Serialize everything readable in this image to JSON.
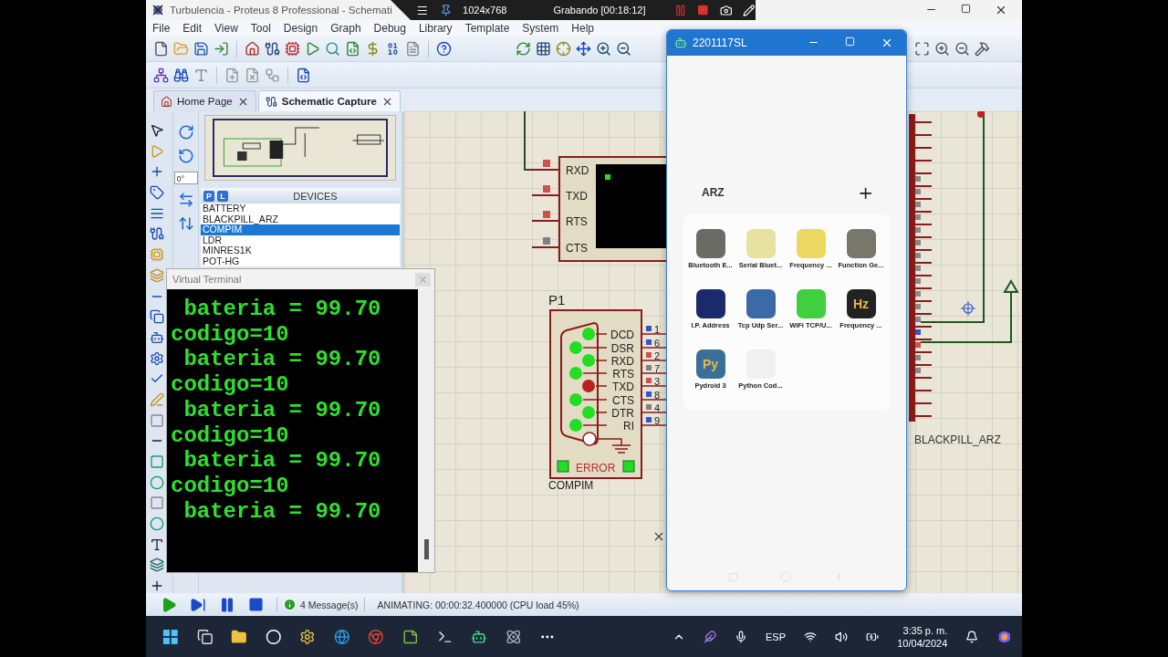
{
  "window": {
    "title": "Turbulencia - Proteus 8 Professional - Schemati"
  },
  "recorder": {
    "resolution": "1024x768",
    "status": "Grabando [00:18:12]"
  },
  "menu": [
    "File",
    "Edit",
    "View",
    "Tool",
    "Design",
    "Graph",
    "Debug",
    "Library",
    "Template",
    "System",
    "Help"
  ],
  "tabs": [
    {
      "label": "Home Page",
      "selected": false
    },
    {
      "label": "Schematic Capture",
      "selected": true
    }
  ],
  "rotation": "0°",
  "devices": {
    "title": "DEVICES",
    "modes": [
      "P",
      "L"
    ],
    "items": [
      {
        "name": "BATTERY",
        "selected": false
      },
      {
        "name": "BLACKPILL_ARZ",
        "selected": false
      },
      {
        "name": "COMPIM",
        "selected": true
      },
      {
        "name": "LDR",
        "selected": false
      },
      {
        "name": "MINRES1K",
        "selected": false
      },
      {
        "name": "POT-HG",
        "selected": false
      }
    ]
  },
  "terminal": {
    "title": "Virtual Terminal",
    "lines": [
      " bateria = 99.70",
      "codigo=10",
      " bateria = 99.70",
      "codigo=10",
      " bateria = 99.70",
      "codigo=10",
      " bateria = 99.70",
      "codigo=10",
      " bateria = 99.70"
    ]
  },
  "schematic": {
    "vt_pins": [
      {
        "label": "RXD",
        "color": "#d05050"
      },
      {
        "label": "TXD",
        "color": "#d05050"
      },
      {
        "label": "RTS",
        "color": "#d05050"
      },
      {
        "label": "CTS",
        "color": "#808080"
      }
    ],
    "compim": {
      "ref": "P1",
      "name": "COMPIM",
      "error": "ERROR",
      "pins": [
        {
          "signal": "DCD",
          "number": "1",
          "color": "#22dd22",
          "marker": {
            "color": "#3355cc"
          }
        },
        {
          "signal": "DSR",
          "number": "6",
          "color": "#22dd22",
          "marker": {
            "color": "#3355cc"
          }
        },
        {
          "signal": "RXD",
          "number": "2",
          "color": "#22dd22",
          "marker": {
            "color": "#d05050"
          }
        },
        {
          "signal": "RTS",
          "number": "7",
          "color": "#22dd22",
          "marker": {
            "color": "#808080"
          }
        },
        {
          "signal": "TXD",
          "number": "3",
          "color": "#bb2020",
          "marker": {
            "color": "#d05050"
          }
        },
        {
          "signal": "CTS",
          "number": "8",
          "color": "#22dd22",
          "marker": {
            "color": "#3355cc"
          }
        },
        {
          "signal": "DTR",
          "number": "4",
          "color": "#22dd22",
          "marker": {
            "color": "#808080"
          }
        },
        {
          "signal": "RI",
          "number": "9",
          "color": "#22dd22",
          "marker": {
            "color": "#3355cc"
          }
        }
      ]
    },
    "mcu_label": "BLACKPILL_ARZ"
  },
  "phone": {
    "title": "2201117SL",
    "folder": "ARZ",
    "add": "+",
    "apps": [
      {
        "label": "Bluetooth E...",
        "color": "#6b6b66"
      },
      {
        "label": "Serial Bluet...",
        "color": "#e8e2a0"
      },
      {
        "label": "Frequency ...",
        "color": "#ecd860"
      },
      {
        "label": "Function Ge...",
        "color": "#77776a"
      },
      {
        "label": "I.P. Address",
        "color": "#1a2a6c"
      },
      {
        "label": "Tcp Udp Ser...",
        "color": "#3a6aa8"
      },
      {
        "label": "WiFi TCP/U...",
        "color": "#3fcf3f"
      },
      {
        "label": "Frequency ...",
        "color": "#222222",
        "glyph": "Hz"
      },
      {
        "label": "Pydroid 3",
        "color": "#3a6f9a",
        "glyph": "Py"
      },
      {
        "label": "Python Cod...",
        "color": "#f0f0f0"
      }
    ]
  },
  "status": {
    "messages": "4 Message(s)",
    "animation": "ANIMATING: 00:00:32.400000 (CPU load 45%)"
  },
  "taskbar": {
    "language": "ESP",
    "time": "3:35 p. m.",
    "date": "10/04/2024"
  }
}
